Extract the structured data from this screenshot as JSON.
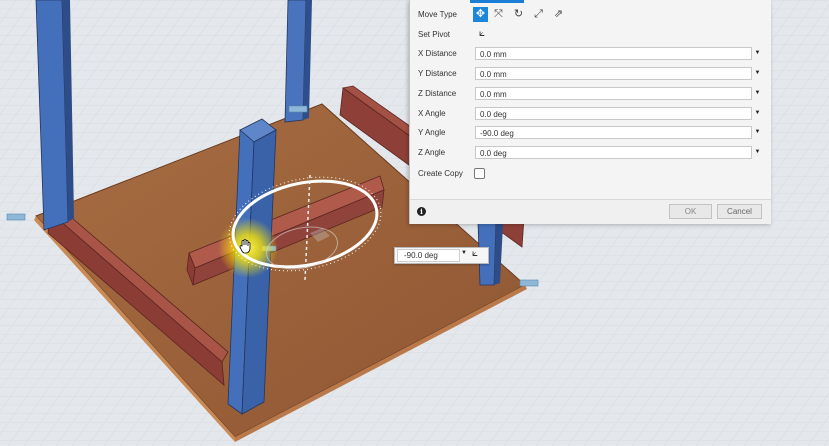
{
  "move_panel": {
    "move_type_label": "Move Type",
    "move_type_icons": [
      "free-move-icon",
      "translate-icon",
      "rotate-icon",
      "point-to-point-icon",
      "point-to-position-icon"
    ],
    "set_pivot_label": "Set Pivot",
    "fields": [
      {
        "label": "X Distance",
        "value": "0.0 mm"
      },
      {
        "label": "Y Distance",
        "value": "0.0 mm"
      },
      {
        "label": "Z Distance",
        "value": "0.0 mm"
      },
      {
        "label": "X Angle",
        "value": "0.0 deg"
      },
      {
        "label": "Y Angle",
        "value": "-90.0 deg"
      },
      {
        "label": "Z Angle",
        "value": "0.0 deg"
      }
    ],
    "create_copy_label": "Create Copy",
    "create_copy_checked": false,
    "ok_label": "OK",
    "cancel_label": "Cancel",
    "accent_color": "#1c86da"
  },
  "angle_input": {
    "value": "-90.0 deg"
  },
  "colors": {
    "board": "#9a5f38",
    "legs": "#3f68b4",
    "rails": "#9c4b42",
    "grid_bg": "#e4e8ec"
  }
}
